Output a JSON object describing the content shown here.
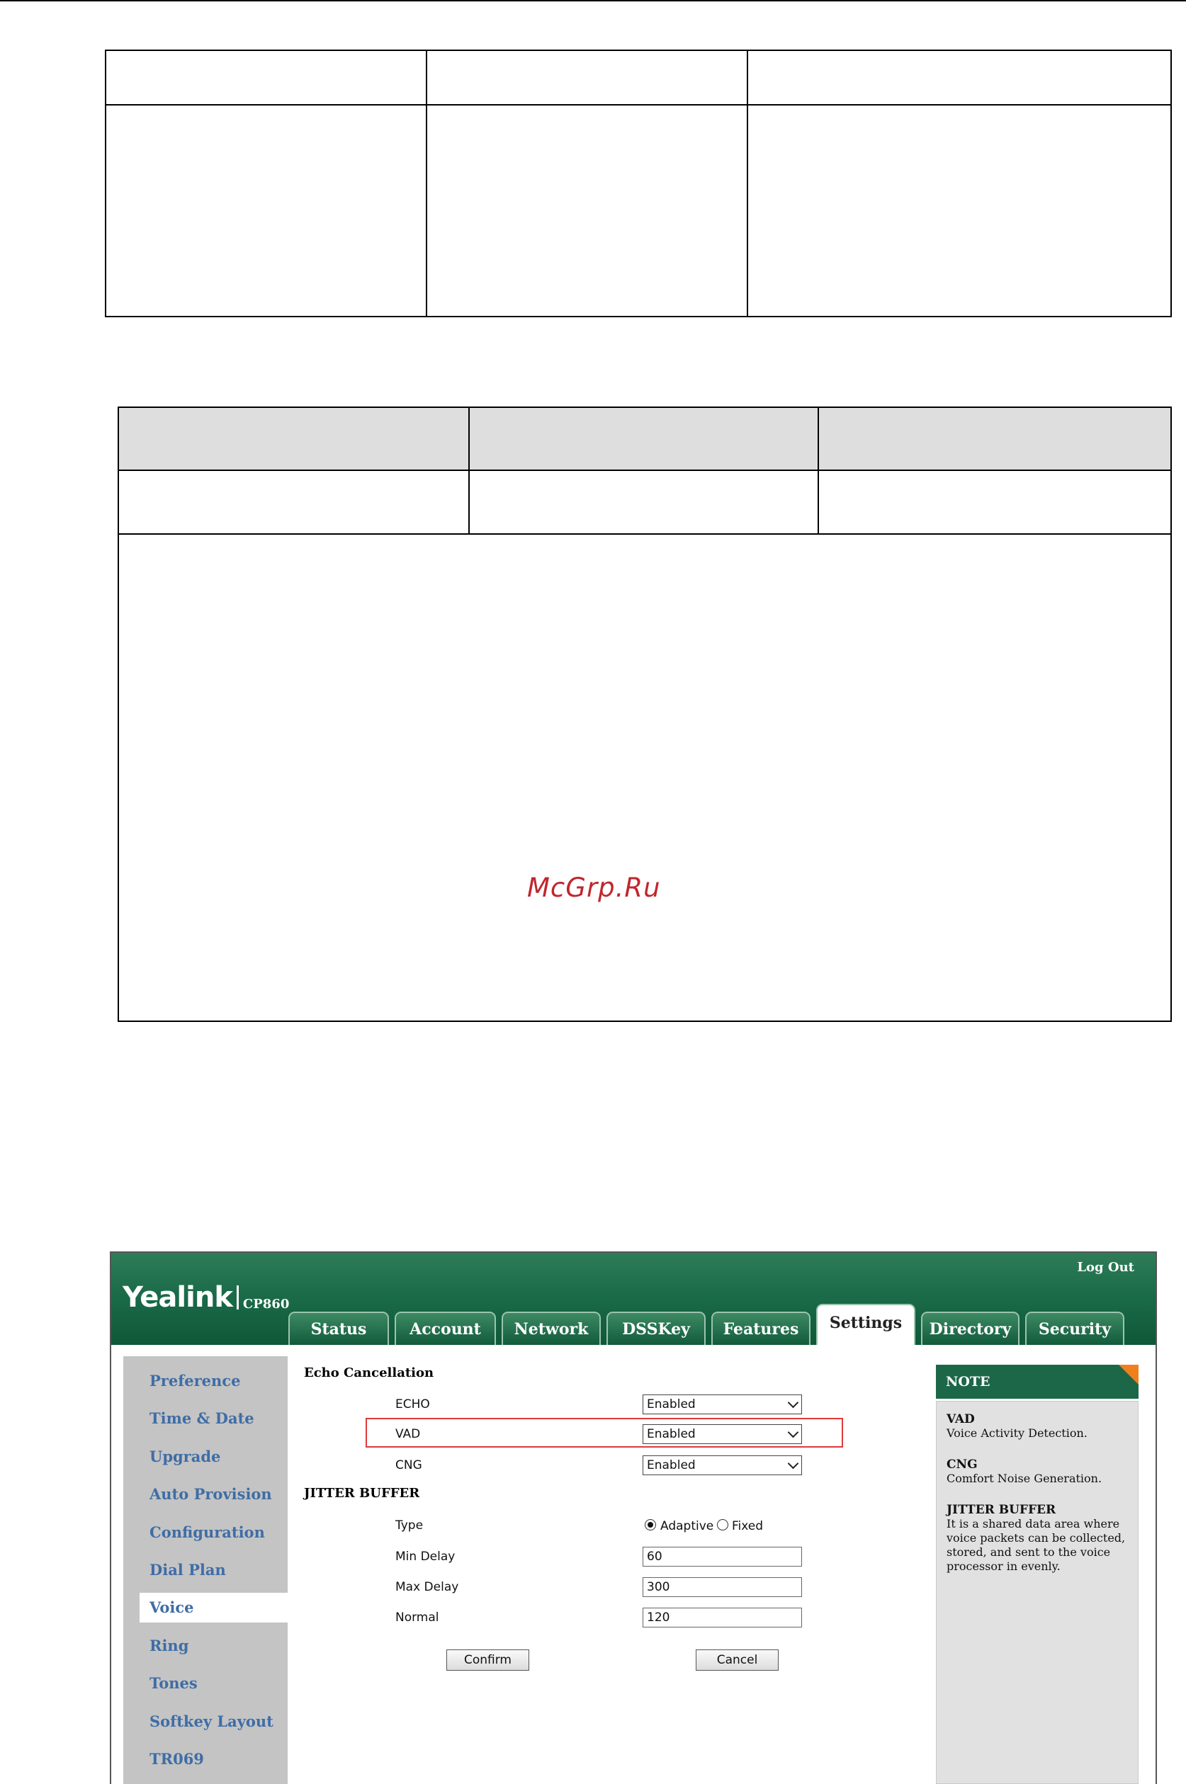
{
  "watermark": "McGrp.Ru",
  "app": {
    "brand": "Yealink",
    "model": "CP860",
    "logout_label": "Log Out"
  },
  "tabs": [
    {
      "label": "Status",
      "active": false
    },
    {
      "label": "Account",
      "active": false
    },
    {
      "label": "Network",
      "active": false
    },
    {
      "label": "DSSKey",
      "active": false
    },
    {
      "label": "Features",
      "active": false
    },
    {
      "label": "Settings",
      "active": true
    },
    {
      "label": "Directory",
      "active": false
    },
    {
      "label": "Security",
      "active": false
    }
  ],
  "sidebar": {
    "items": [
      {
        "label": "Preference"
      },
      {
        "label": "Time & Date"
      },
      {
        "label": "Upgrade"
      },
      {
        "label": "Auto Provision"
      },
      {
        "label": "Configuration"
      },
      {
        "label": "Dial Plan"
      },
      {
        "label": "Voice",
        "active": true
      },
      {
        "label": "Ring"
      },
      {
        "label": "Tones"
      },
      {
        "label": "Softkey Layout"
      },
      {
        "label": "TR069"
      }
    ]
  },
  "form": {
    "echo_cancellation_title": "Echo Cancellation",
    "echo": {
      "label": "ECHO",
      "value": "Enabled"
    },
    "vad": {
      "label": "VAD",
      "value": "Enabled"
    },
    "cng": {
      "label": "CNG",
      "value": "Enabled"
    },
    "jitter_title": "JITTER BUFFER",
    "type": {
      "label": "Type",
      "options": [
        "Adaptive",
        "Fixed"
      ],
      "selected": "Adaptive"
    },
    "min_delay": {
      "label": "Min Delay",
      "value": "60"
    },
    "max_delay": {
      "label": "Max Delay",
      "value": "300"
    },
    "normal": {
      "label": "Normal",
      "value": "120"
    },
    "confirm_label": "Confirm",
    "cancel_label": "Cancel"
  },
  "note": {
    "title": "NOTE",
    "entries": [
      {
        "term": "VAD",
        "desc": "Voice Activity Detection."
      },
      {
        "term": "CNG",
        "desc": "Comfort Noise Generation."
      },
      {
        "term": "JITTER BUFFER",
        "desc_lines": [
          "It is a shared data area where",
          "voice packets can be collected,",
          "stored, and sent to the voice",
          "processor in evenly."
        ]
      }
    ]
  },
  "colors": {
    "header_green": "#1b6b49",
    "sidebar_link": "#3f6da6",
    "highlight_red": "#e03a3a",
    "note_corner": "#f07f1e",
    "watermark": "#c0272d"
  }
}
